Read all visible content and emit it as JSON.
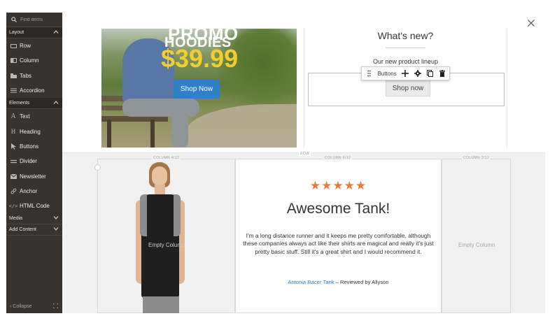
{
  "sidebar": {
    "search_placeholder": "Find items",
    "sections": {
      "layout": "Layout",
      "elements": "Elements",
      "media": "Media",
      "add_content": "Add Content"
    },
    "layout_items": [
      "Row",
      "Column",
      "Tabs",
      "Accordion"
    ],
    "element_items": [
      "Text",
      "Heading",
      "Buttons",
      "Divider",
      "Newsletter",
      "Anchor",
      "HTML Code"
    ],
    "collapse_label": "Collapse"
  },
  "promo": {
    "line1": "PROMO",
    "line2": "HOODIES",
    "price": "$39.99",
    "button": "Shop Now"
  },
  "whats_new": {
    "title": "What's new?",
    "subtitle": "Our new product lineup",
    "button": "Shop now"
  },
  "toolbar": {
    "label": "Buttons"
  },
  "layout_labels": {
    "row": "ROW",
    "column_left": "COLUMN 4/12",
    "column_mid": "COLUMN 6/12",
    "column_right": "COLUMN 2/12"
  },
  "columns": {
    "empty_left": "Empty Column",
    "empty_right": "Empty Column"
  },
  "product": {
    "stars": "★★★★★",
    "title": "Awesome Tank!",
    "review": "I'm a long distance runner and it keeps me pretty comfortable, although these companies always act like their shirts are magical and really it's just pretty basic stuff. Still it's a great shirt and I would recommend it.",
    "link": "Antonia Racer Tank",
    "reviewed_by": " – Reviewed by Allyson"
  },
  "colors": {
    "sidebar_bg": "#373330",
    "star": "#e97b3a",
    "promo_button": "#2f80c9",
    "price": "#f3cc2f",
    "link": "#2a77c4"
  }
}
